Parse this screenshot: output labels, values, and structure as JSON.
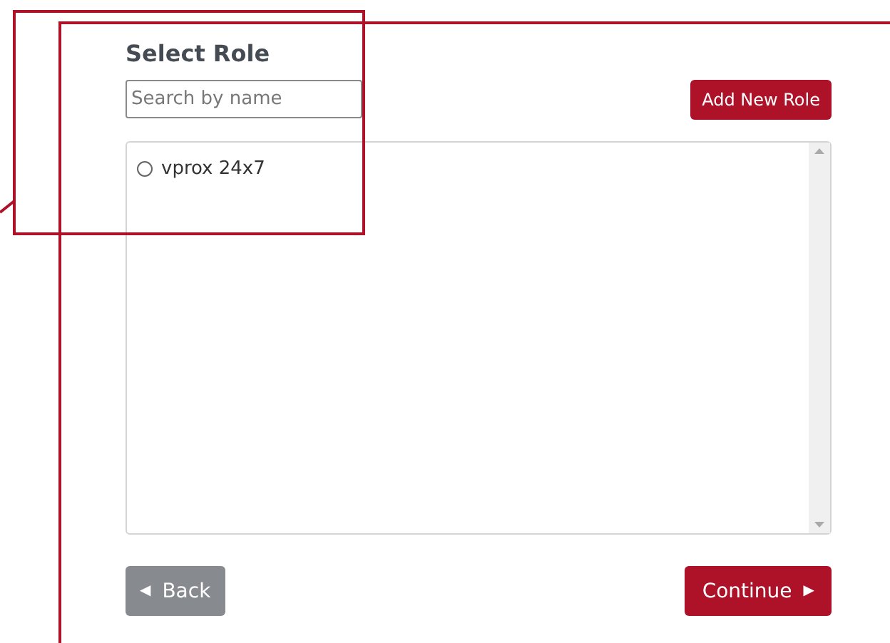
{
  "title": "Select Role",
  "search": {
    "placeholder": "Search by name"
  },
  "add_button": "Add New Role",
  "roles": [
    {
      "label": "vprox 24x7",
      "selected": false
    }
  ],
  "back_button": {
    "label": "Back",
    "icon": "◀"
  },
  "continue_button": {
    "label": "Continue",
    "icon": "▶"
  }
}
